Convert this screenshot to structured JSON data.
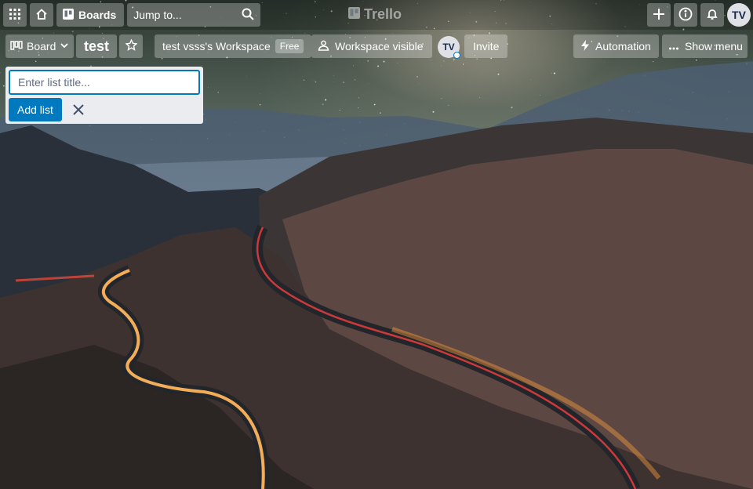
{
  "header": {
    "apps_icon": "grid-icon",
    "home_icon": "home-icon",
    "boards_label": "Boards",
    "search": {
      "placeholder": "Jump to...",
      "icon": "search-icon"
    },
    "logo_text": "Trello",
    "create_icon": "plus-icon",
    "info_icon": "info-icon",
    "notifications_icon": "bell-icon",
    "user_initials": "TV"
  },
  "board_bar": {
    "view_label": "Board",
    "title": "test",
    "star_icon": "star-icon",
    "workspace_label": "test vsss's Workspace",
    "workspace_badge": "Free",
    "visibility_label": "Workspace visible",
    "member_initials": "TV",
    "invite_label": "Invite",
    "automation_label": "Automation",
    "show_menu_label": "Show menu"
  },
  "composer": {
    "placeholder": "Enter list title...",
    "value": "",
    "add_label": "Add list",
    "close_icon": "close-icon"
  },
  "colors": {
    "primary": "#0079bf",
    "composer_bg": "#ebecf0",
    "header_button_bg": "rgba(255,255,255,0.28)"
  }
}
